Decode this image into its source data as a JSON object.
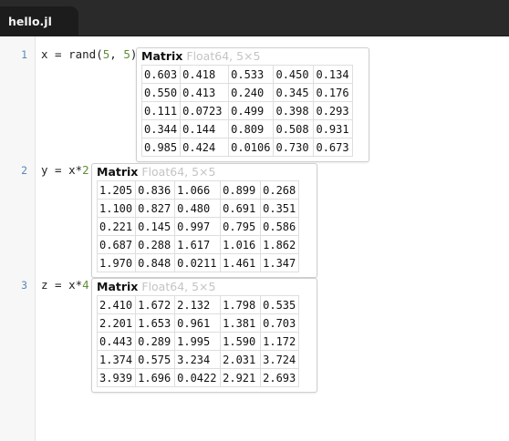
{
  "tab": {
    "title": "hello.jl"
  },
  "lines": [
    {
      "number": "1",
      "parts": [
        {
          "t": "x = rand("
        },
        {
          "t": "5",
          "c": "num"
        },
        {
          "t": ", "
        },
        {
          "t": "5",
          "c": "num"
        },
        {
          "t": ")"
        }
      ]
    },
    {
      "number": "2",
      "parts": [
        {
          "t": "y = x*"
        },
        {
          "t": "2",
          "c": "num"
        }
      ]
    },
    {
      "number": "3",
      "parts": [
        {
          "t": "z = x*"
        },
        {
          "t": "4",
          "c": "num"
        }
      ]
    }
  ],
  "results": [
    {
      "type": "Matrix",
      "meta": "Float64, 5×5",
      "rows": [
        [
          "0.603",
          "0.418",
          "0.533",
          "0.450",
          "0.134"
        ],
        [
          "0.550",
          "0.413",
          "0.240",
          "0.345",
          "0.176"
        ],
        [
          "0.111",
          "0.0723",
          "0.499",
          "0.398",
          "0.293"
        ],
        [
          "0.344",
          "0.144",
          "0.809",
          "0.508",
          "0.931"
        ],
        [
          "0.985",
          "0.424",
          "0.0106",
          "0.730",
          "0.673"
        ]
      ]
    },
    {
      "type": "Matrix",
      "meta": "Float64, 5×5",
      "rows": [
        [
          "1.205",
          "0.836",
          "1.066",
          "0.899",
          "0.268"
        ],
        [
          "1.100",
          "0.827",
          "0.480",
          "0.691",
          "0.351"
        ],
        [
          "0.221",
          "0.145",
          "0.997",
          "0.795",
          "0.586"
        ],
        [
          "0.687",
          "0.288",
          "1.617",
          "1.016",
          "1.862"
        ],
        [
          "1.970",
          "0.848",
          "0.0211",
          "1.461",
          "1.347"
        ]
      ]
    },
    {
      "type": "Matrix",
      "meta": "Float64, 5×5",
      "rows": [
        [
          "2.410",
          "1.672",
          "2.132",
          "1.798",
          "0.535"
        ],
        [
          "2.201",
          "1.653",
          "0.961",
          "1.381",
          "0.703"
        ],
        [
          "0.443",
          "0.289",
          "1.995",
          "1.590",
          "1.172"
        ],
        [
          "1.374",
          "0.575",
          "3.234",
          "2.031",
          "3.724"
        ],
        [
          "3.939",
          "1.696",
          "0.0422",
          "2.921",
          "2.693"
        ]
      ]
    }
  ]
}
